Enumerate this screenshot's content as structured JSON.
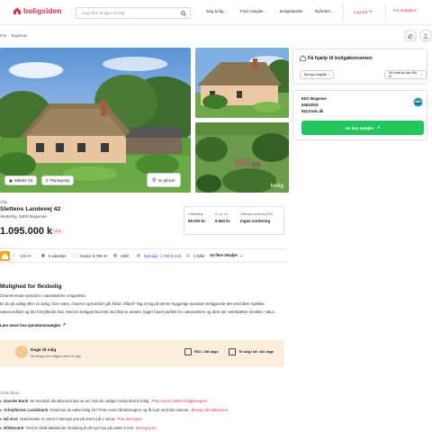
{
  "header": {
    "logo_text": "boligsiden",
    "search_placeholder": "Søg efter boliger til salg",
    "nav": [
      {
        "label": "Søg bolig",
        "chevron": true
      },
      {
        "label": "Find mægler",
        "chevron": true
      },
      {
        "label": "Boligstatistik",
        "chevron": false
      },
      {
        "label": "Nyheder",
        "chevron": true
      }
    ],
    "login_label": "Log ind",
    "favorites_label": "For mæglere"
  },
  "breadcrumb": [
    "Fyn",
    "Bogense"
  ],
  "top_actions": [
    "like-icon",
    "share-icon"
  ],
  "gallery": {
    "photos_button": "Billeder (5)",
    "floorplan_button": "Plantegning",
    "map_button": "Se på kort",
    "watermark": "bolig"
  },
  "property": {
    "type": "Villa",
    "street": "Slettens Landevej 42",
    "city": "Vesterby, 5400 Bogense",
    "price": "1.095.000 kr.",
    "price_change": "-4 %"
  },
  "stats": [
    {
      "label": "Udbetaling",
      "value": "55.000 kr."
    },
    {
      "label": "Kr. pr. m²",
      "value": "6.564 kr."
    },
    {
      "label": "Offentlig vurdering 2022",
      "value": "Ingen vurdering"
    }
  ],
  "facts": [
    {
      "icon": "area-icon",
      "text": "166 m²",
      "blue": true
    },
    {
      "icon": "rooms-icon",
      "text": "6 værelser",
      "blue": false
    },
    {
      "icon": "ground-icon",
      "text": "Grund: 5.780 m²",
      "blue": false
    },
    {
      "icon": "built-icon",
      "text": "1910",
      "blue": false
    },
    {
      "icon": "cost-icon",
      "text": "Ejerudg.: 1.709 kr./md.",
      "blue": true
    },
    {
      "icon": "toilet-icon",
      "text": "1 toilet",
      "blue": false
    }
  ],
  "facts_link": "Se flere detaljer",
  "description": {
    "title": "Mulighed for flexbolig",
    "subtitle": "Charmerende ejendom i naturskønne omgivelser.",
    "body": "Er du på udkig efter en bolig, hvor natur, charme og komfort går hånd i hånd? Tag et kig på denne hyggelige ejendom beliggende tæt ved både stylslike naturområder og det fortryllende hav. Med en beliggenhed tæt ved åbene arealer, ligger huset perfekt for naturelskere og dem der værdsætter smukke, natur...",
    "read_more": "Læs mere hos ejendomsmægler"
  },
  "days_for_sale": {
    "title": "Dage til salg",
    "subtitle": "Så længe har boligen været til salg",
    "agent_days": "EDC: 286 dage",
    "total_days": "Til salg i alt: 432 dage"
  },
  "useful_links": {
    "title": "Gode tilbud",
    "rows": [
      {
        "bank": "Danske Bank",
        "text": "Se hvordan din økonomi kan se ud, hvis du vælger netop denne bolig.",
        "link": "Prøv vores unikke boligberegner"
      },
      {
        "bank": "Arbejdernes Landsbank",
        "text": "Hvad kan du købe bolig for? Prøv vores låneberegner og få svar med det samme.",
        "link": "Beregn din købsevne"
      },
      {
        "bank": "Nå GoS",
        "text": "Hvad koster en storm? Beregn pris på storm på 1 minut.",
        "link": "Prøv beregner"
      },
      {
        "bank": "Effektværk",
        "text": "Find en fuldt dækkende forsikring til dit nye hus på under 5 min.",
        "link": "Beregn pris"
      }
    ]
  },
  "economy_panel": {
    "title": "Få hjælp til boligøkonomien",
    "button_1": "Beregn boliglån",
    "button_2": "Se hvad du har råd til"
  },
  "agent_panel": {
    "name": "EDC Bogense",
    "phone": "64811915",
    "email": "541@edc.dk",
    "button": "Se hos mægler"
  },
  "colors": {
    "brand": "#e5304a",
    "cta": "#22c55e",
    "days_bg": "#fbeedd",
    "energy": "#f5a524"
  }
}
